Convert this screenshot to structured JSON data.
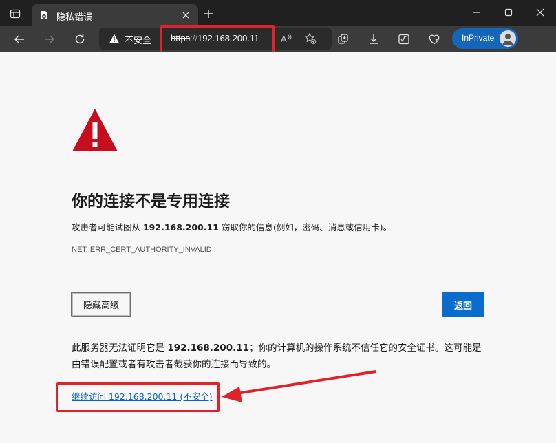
{
  "browser": {
    "tab_title": "隐私错误",
    "inprivate_label": "InPrivate",
    "address": {
      "security_label": "不安全",
      "scheme": "https",
      "separator": "://",
      "host": "192.168.200.11"
    },
    "icons": {
      "workspaces": "workspaces-icon",
      "tab_favicon": "broken-lock-icon",
      "tab_close": "close-icon",
      "new_tab": "plus-icon",
      "minimize": "minimize-icon",
      "maximize": "maximize-icon",
      "close_window": "close-icon",
      "back": "arrow-left-icon",
      "forward": "arrow-right-icon",
      "refresh": "refresh-icon",
      "read_aloud": "read-aloud-icon",
      "favorites": "star-add-icon",
      "collections": "collections-icon",
      "downloads": "download-icon",
      "math_solver": "math-icon",
      "browser_essentials": "heart-shield-icon",
      "profile": "avatar"
    }
  },
  "page": {
    "title": "你的连接不是专用连接",
    "desc_prefix": "攻击者可能试图从 ",
    "desc_host": "192.168.200.11",
    "desc_suffix": " 窃取你的信息(例如，密码、消息或信用卡)。",
    "error_code": "NET::ERR_CERT_AUTHORITY_INVALID",
    "advanced_button": "隐藏高级",
    "back_button": "返回",
    "explain_prefix": "此服务器无法证明它是 ",
    "explain_host": "192.168.200.11",
    "explain_suffix": "；你的计算机的操作系统不信任它的安全证书。这可能是由错误配置或者有攻击者截获你的连接而导致的。",
    "proceed_link": "继续访问 192.168.200.11 (不安全)"
  },
  "colors": {
    "titlebar": "#202020",
    "toolbar": "#3b3b3b",
    "page_bg": "#f7f7f7",
    "warning_red": "#c50f1f",
    "primary_blue": "#0a6ccd",
    "link_blue": "#0a63c4",
    "annotation_red": "#e0222a",
    "inprivate_blue": "#1565b8"
  }
}
